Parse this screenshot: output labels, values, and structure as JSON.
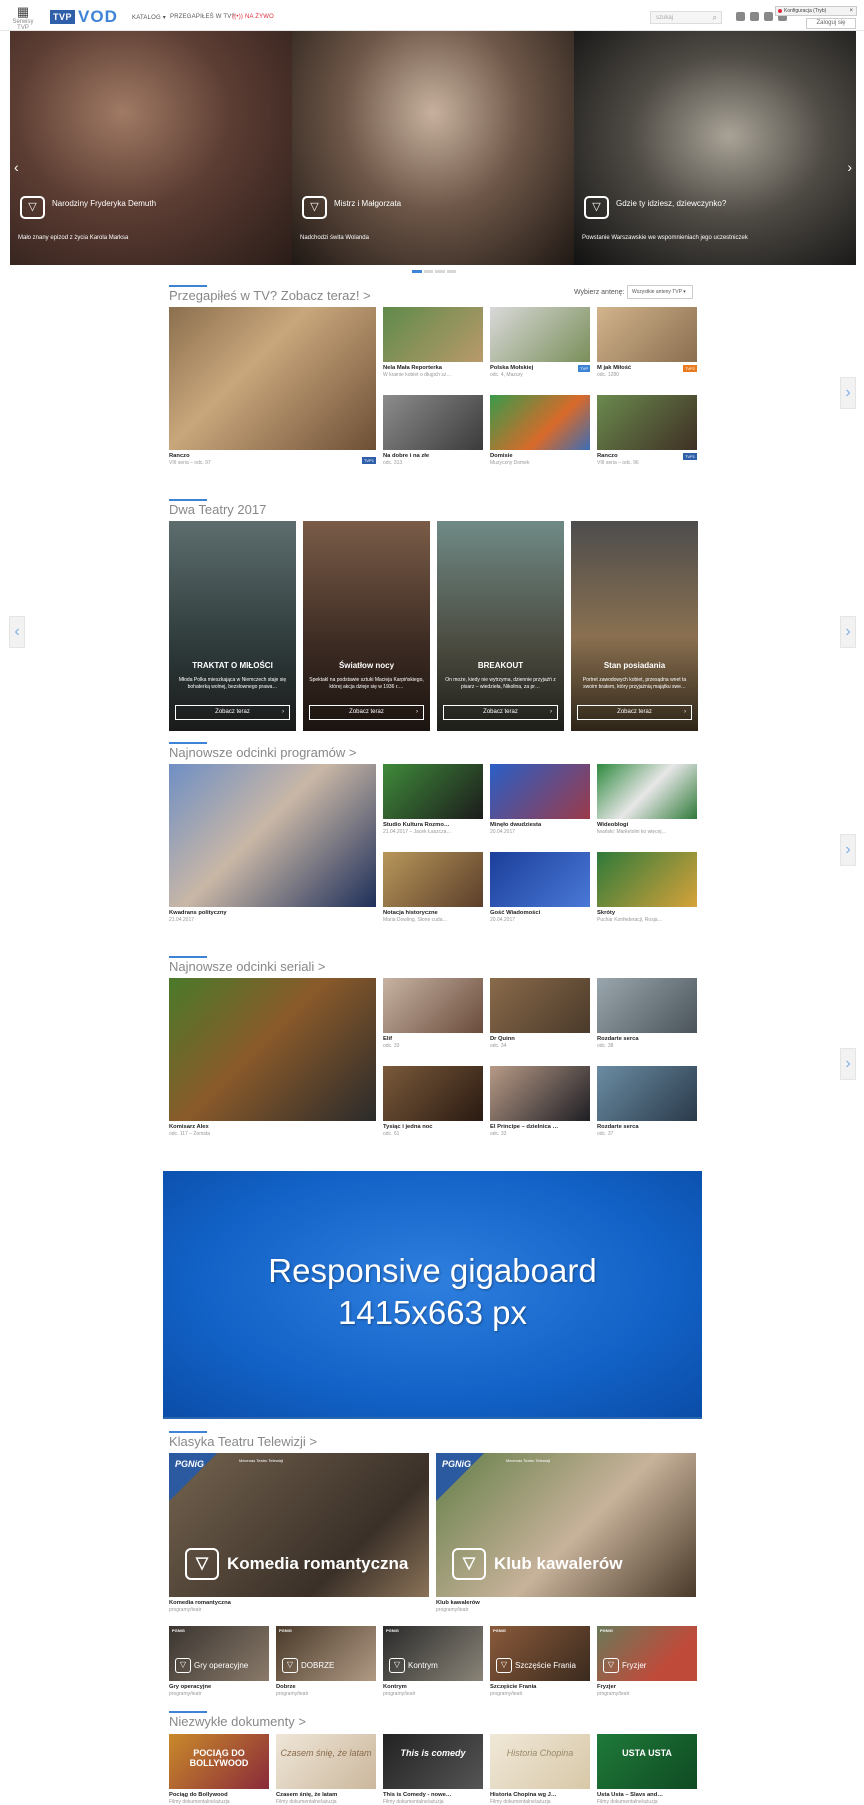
{
  "header": {
    "apps_label": "Serwisy TVP",
    "logo_tvp": "TVP",
    "logo_vod": "VOD",
    "nav": [
      "KATALOG ▾",
      "PRZEGAPIŁEŚ W TV?",
      "((•)) NA ŻYWO"
    ],
    "search_placeholder": "szukaj",
    "notification": "Konfiguracja (Tryb)",
    "login": "Zaloguj się"
  },
  "hero": [
    {
      "title": "Narodziny Fryderyka Demuth",
      "desc": "Mało znany epizod z życia Karola Marksa"
    },
    {
      "title": "Mistrz i Małgorzata",
      "desc": "Nadchodzi świta Wolanda"
    },
    {
      "title": "Gdzie ty idziesz, dziewczynko?",
      "desc": "Powstanie Warszawskie we wspomnieniach jego uczestniczek"
    }
  ],
  "sections": {
    "missed": "Przegapiłeś w TV? Zobacz teraz! >",
    "theatres": "Dwa Teatry 2017",
    "programs": "Najnowsze odcinki programów >",
    "series": "Najnowsze odcinki seriali >",
    "classic": "Klasyka Teatru Telewizji >",
    "docs": "Niezwykłe dokumenty >"
  },
  "antenna": {
    "label": "Wybierz antenę:",
    "value": "Wszystkie anteny TVP ▾"
  },
  "missed_tiles": [
    {
      "title": "Ranczo",
      "sub": "VIII seria – odc. 97",
      "ch": "TVP1"
    },
    {
      "title": "Nela Mała Reporterka",
      "sub": "W krainie kobiet o długich sz…",
      "ch": ""
    },
    {
      "title": "Polska Mołskiej",
      "sub": "odc. 4, Mazury",
      "ch": "TVP"
    },
    {
      "title": "M jak Miłość",
      "sub": "odc. 1280",
      "ch": "TVP2"
    },
    {
      "title": "Na dobre i na złe",
      "sub": "odc. 313",
      "ch": ""
    },
    {
      "title": "Domisie",
      "sub": "Muzyczny Domek",
      "ch": ""
    },
    {
      "title": "Ranczo",
      "sub": "VIII seria – odc. 96",
      "ch": "TVP1"
    }
  ],
  "theatres": [
    {
      "title": "TRAKTAT O MIŁOŚCI",
      "desc": "Młoda Polka mieszkająca w Niemczech staje się bohaterką wolnej, bezsłownego prawa…",
      "btn": "Zobacz teraz",
      "bg": "#2f3a3c"
    },
    {
      "title": "Światłow nocy",
      "desc": "Spektakl na podstawie sztuki Macieja Karpińskiego, której akcja dzieje się w 1936 r.…",
      "btn": "Zobacz teraz",
      "bg": "#4d3a31"
    },
    {
      "title": "BREAKOUT",
      "desc": "On może, kiedy nie wytrzyma, dziennie przyjaźń z pisarz – wiedzieła, Nikolina, za pr…",
      "btn": "Zobacz teraz",
      "bg": "#5a5648"
    },
    {
      "title": "Stan posiadania",
      "desc": "Portret zawodowych kobiet, przesądna wnet ta swoim bratem, który przyjaźnią majątku swe…",
      "btn": "Zobacz teraz",
      "bg": "#6b5a3f"
    }
  ],
  "programs": [
    {
      "title": "Kwadrans polityczny",
      "sub": "21.04.2017"
    },
    {
      "title": "Studio Kultura Rozmo…",
      "sub": "21.04.2017 – Jacek Łaszcza…"
    },
    {
      "title": "Minęło dwudziesta",
      "sub": "20.04.2017"
    },
    {
      "title": "Wideoblogi",
      "sub": "Iwański: Marketolni ko więcej…"
    },
    {
      "title": "Notacja historyczne",
      "sub": "Maria Dowling. Słone cuda…"
    },
    {
      "title": "Gość Wiadomości",
      "sub": "20.04.2017"
    },
    {
      "title": "Skróty",
      "sub": "Puchar Konfederacji, Rosja…"
    }
  ],
  "series": [
    {
      "title": "Komisarz Alex",
      "sub": "odc. 117 – Zemsta"
    },
    {
      "title": "Elif",
      "sub": "odc. 33"
    },
    {
      "title": "Dr Quinn",
      "sub": "odc. 34"
    },
    {
      "title": "Rozdarte serca",
      "sub": "odc. 38"
    },
    {
      "title": "Tysiąc i jedna noc",
      "sub": "odc. 61"
    },
    {
      "title": "El Principe – dzielnica …",
      "sub": "odc. 33"
    },
    {
      "title": "Rozdarte serca",
      "sub": "odc. 37"
    }
  ],
  "giga": {
    "line1": "Responsive gigaboard",
    "line2": "1415x663 px"
  },
  "classic_big": [
    {
      "title": "Komedia romantyczna",
      "sub": "programy/teatr",
      "banner": "Komedia romantyczna"
    },
    {
      "title": "Klub kawalerów",
      "sub": "programy/teatr",
      "banner": "Klub kawalerów"
    }
  ],
  "classic_brand": "PGNiG",
  "classic_brand_sub": "Mecenas Teatru Telewizji",
  "classic_small": [
    {
      "title": "Gry operacyjne",
      "sub": "programy/teatr",
      "banner": "Gry operacyjne"
    },
    {
      "title": "Dobrze",
      "sub": "programy/teatr",
      "banner": "DOBRZE"
    },
    {
      "title": "Kontrym",
      "sub": "programy/teatr",
      "banner": "Kontrym"
    },
    {
      "title": "Szczęście Frania",
      "sub": "programy/teatr",
      "banner": "Szczęście Frania"
    },
    {
      "title": "Fryzjer",
      "sub": "programy/teatr",
      "banner": "Fryzjer"
    }
  ],
  "docs": [
    {
      "title": "Pociąg do Bollywood",
      "sub": "Filmy dokumentalne/ażuzja",
      "art": "POCIĄG DO BOLLYWOOD"
    },
    {
      "title": "Czasem śnię, że latam",
      "sub": "Filmy dokumentalne/ażuzja",
      "art": "Czasem śnię, że latam"
    },
    {
      "title": "This is Comedy - nowe…",
      "sub": "Filmy dokumentalne/ażuzja",
      "art": "This is comedy"
    },
    {
      "title": "Historia Chopina wg J…",
      "sub": "Filmy dokumentalne/ażuzja",
      "art": "Historia Chopina"
    },
    {
      "title": "Usta Usta – Slavs and…",
      "sub": "Filmy dokumentalne/ażuzja",
      "art": "USTA USTA"
    }
  ]
}
